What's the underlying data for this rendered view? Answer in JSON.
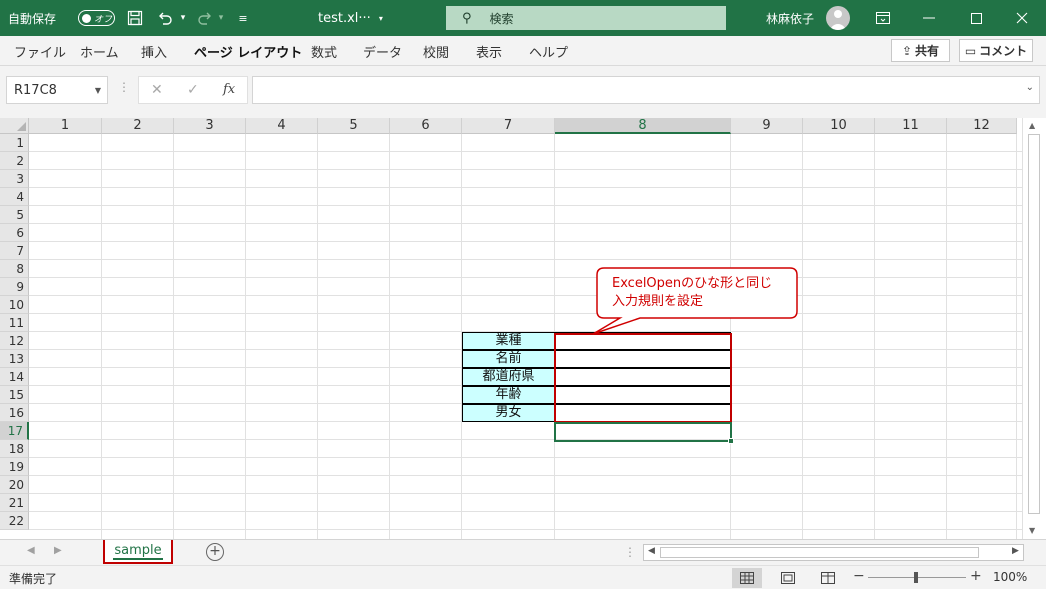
{
  "titlebar": {
    "autosave_label": "自動保存",
    "toggle_text": "オフ",
    "file_title": "test.xl···",
    "search_placeholder": "検索",
    "user_name": "林麻依子"
  },
  "ribbon": {
    "tabs": [
      "ファイル",
      "ホーム",
      "挿入",
      "ページ レイアウト",
      "数式",
      "データ",
      "校閲",
      "表示",
      "ヘルプ"
    ],
    "active_tab": "ページ レイアウト",
    "share_label": "共有",
    "comment_label": "コメント"
  },
  "formula_bar": {
    "name_box": "R17C8",
    "value": ""
  },
  "grid": {
    "columns": [
      "1",
      "2",
      "3",
      "4",
      "5",
      "6",
      "7",
      "8",
      "9",
      "10",
      "11",
      "12"
    ],
    "selected_column": "8",
    "rows": [
      "1",
      "2",
      "3",
      "4",
      "5",
      "6",
      "7",
      "8",
      "9",
      "10",
      "11",
      "12",
      "13",
      "14",
      "15",
      "16",
      "17",
      "18",
      "19",
      "20",
      "21",
      "22"
    ],
    "selected_row": "17",
    "form_labels": [
      "業種",
      "名前",
      "都道府県",
      "年齢",
      "男女"
    ]
  },
  "callout": {
    "line1": "ExcelOpenのひな形と同じ",
    "line2": "入力規則を設定"
  },
  "sheets": {
    "tabs": [
      "sample"
    ],
    "active": "sample"
  },
  "status": {
    "text": "準備完了",
    "zoom": "100%",
    "zoom_level": 1.0
  },
  "colors": {
    "excel_green": "#217346",
    "highlight_red": "#c00000",
    "label_fill": "#ccffff"
  }
}
